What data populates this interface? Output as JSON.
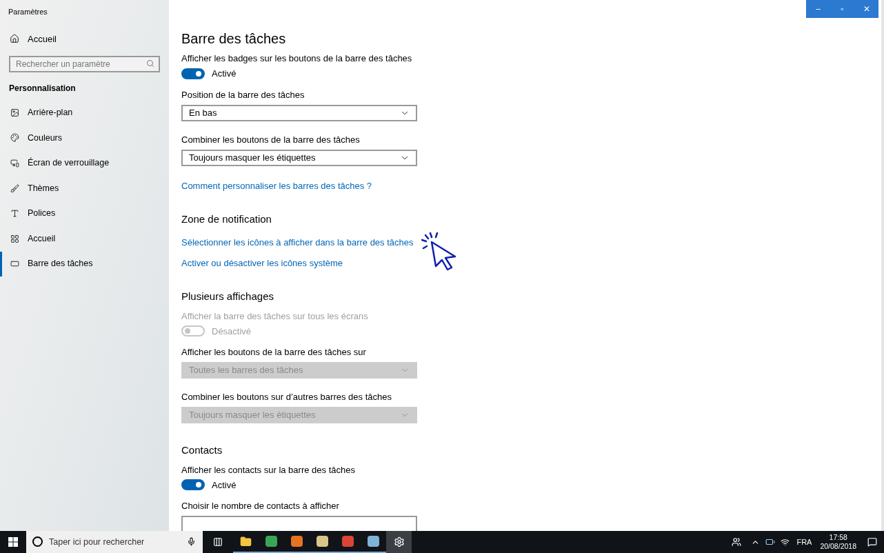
{
  "window": {
    "title": "Paramètres",
    "controls": [
      "–",
      "▫",
      "✕"
    ]
  },
  "sidebar": {
    "home": "Accueil",
    "search": {
      "placeholder": "Rechercher un paramètre"
    },
    "group": "Personnalisation",
    "items": [
      {
        "label": "Arrière-plan",
        "selected": false
      },
      {
        "label": "Couleurs",
        "selected": false
      },
      {
        "label": "Écran de verrouillage",
        "selected": false
      },
      {
        "label": "Thèmes",
        "selected": false
      },
      {
        "label": "Polices",
        "selected": false
      },
      {
        "label": "Accueil",
        "selected": false
      },
      {
        "label": "Barre des tâches",
        "selected": true
      }
    ]
  },
  "page": {
    "title": "Barre des tâches"
  },
  "sections": [
    {
      "items": [
        {
          "kind": "label",
          "text": "Afficher les badges sur les boutons de la barre des tâches",
          "disabled": false
        },
        {
          "kind": "toggle",
          "on": true,
          "disabled": false,
          "text": "Activé"
        },
        {
          "kind": "label",
          "text": "Position de la barre des tâches",
          "disabled": false
        },
        {
          "kind": "dropdown",
          "value": "En bas",
          "disabled": false
        },
        {
          "kind": "label",
          "text": "Combiner les boutons de la barre des tâches",
          "disabled": false
        },
        {
          "kind": "dropdown",
          "value": "Toujours masquer les étiquettes",
          "disabled": false
        },
        {
          "kind": "link",
          "text": "Comment personnaliser les barres des tâches ?",
          "highlighted": false
        }
      ]
    },
    {
      "title": "Zone de notification",
      "items": [
        {
          "kind": "link",
          "text": "Sélectionner les icônes à afficher dans la barre des tâches",
          "highlighted": true
        },
        {
          "kind": "link",
          "text": "Activer ou désactiver les icônes système",
          "highlighted": false
        }
      ]
    },
    {
      "title": "Plusieurs affichages",
      "items": [
        {
          "kind": "label",
          "text": "Afficher la barre des tâches sur tous les écrans",
          "disabled": true
        },
        {
          "kind": "toggle",
          "on": false,
          "disabled": true,
          "text": "Désactivé"
        },
        {
          "kind": "label",
          "text": "Afficher les boutons de la barre des tâches sur",
          "disabled": false
        },
        {
          "kind": "dropdown",
          "value": "Toutes les barres des tâches",
          "disabled": true
        },
        {
          "kind": "label",
          "text": "Combiner les boutons sur d’autres barres des tâches",
          "disabled": false
        },
        {
          "kind": "dropdown",
          "value": "Toujours masquer les étiquettes",
          "disabled": true
        }
      ]
    },
    {
      "title": "Contacts",
      "items": [
        {
          "kind": "label",
          "text": "Afficher les contacts sur la barre des tâches",
          "disabled": false
        },
        {
          "kind": "toggle",
          "on": true,
          "disabled": false,
          "text": "Activé"
        },
        {
          "kind": "label",
          "text": "Choisir le nombre de contacts à afficher",
          "disabled": false
        },
        {
          "kind": "dropdown",
          "disabled": false
        }
      ]
    }
  ],
  "taskbar": {
    "search": {
      "placeholder": "Taper ici pour rechercher"
    },
    "language": "FRA",
    "time": "17:58",
    "date": "20/08/2018"
  }
}
